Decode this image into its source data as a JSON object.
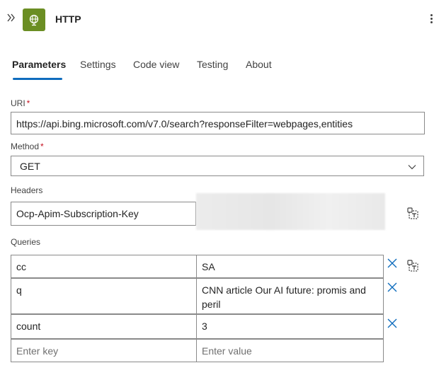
{
  "header": {
    "collapse_icon": "double-chevron-right-icon",
    "action_icon": "globe-icon",
    "brand_color": "#6b8e23",
    "title": "HTTP",
    "more_icon": "more-vertical-icon"
  },
  "tabs": [
    {
      "label": "Parameters",
      "active": true
    },
    {
      "label": "Settings",
      "active": false
    },
    {
      "label": "Code view",
      "active": false
    },
    {
      "label": "Testing",
      "active": false
    },
    {
      "label": "About",
      "active": false
    }
  ],
  "accent_color": "#0f6cbd",
  "uri": {
    "label": "URI",
    "required_mark": "*",
    "value": "https://api.bing.microsoft.com/v7.0/search?responseFilter=webpages,entities"
  },
  "method": {
    "label": "Method",
    "required_mark": "*",
    "value": "GET"
  },
  "headers": {
    "label": "Headers",
    "rows": [
      {
        "key": "Ocp-Apim-Subscription-Key",
        "value_hidden": true
      }
    ]
  },
  "queries": {
    "label": "Queries",
    "rows": [
      {
        "key": "cc",
        "value": "SA"
      },
      {
        "key": "q",
        "value": "CNN article Our AI future: promis and peril"
      },
      {
        "key": "count",
        "value": "3"
      }
    ],
    "key_placeholder": "Enter key",
    "value_placeholder": "Enter value"
  }
}
